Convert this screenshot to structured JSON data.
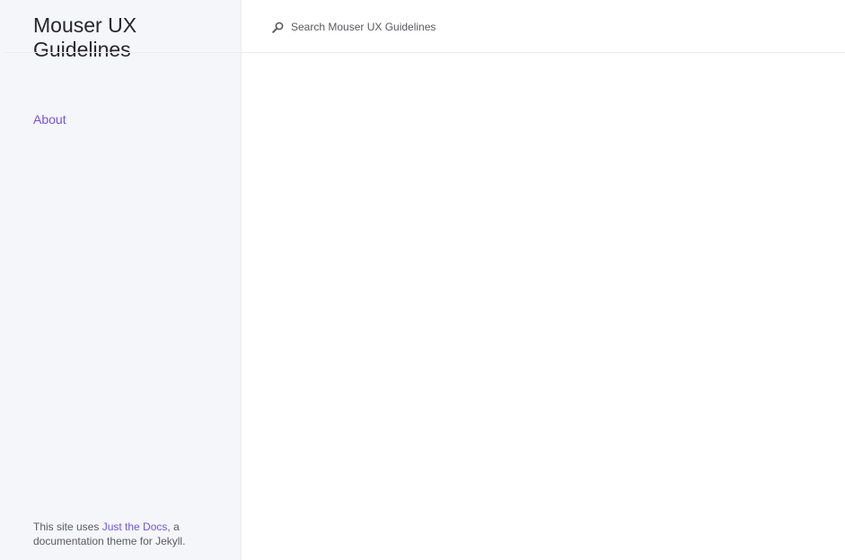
{
  "site": {
    "title": "Mouser UX Guidelines"
  },
  "nav": {
    "items": [
      {
        "label": "About"
      }
    ]
  },
  "search": {
    "placeholder": "Search Mouser UX Guidelines",
    "icon": "search-icon"
  },
  "footer": {
    "prefix": "This site uses ",
    "link_label": "Just the Docs",
    "suffix": ", a documentation theme for Jekyll."
  },
  "colors": {
    "sidebar_bg": "#f5f6fa",
    "link": "#7253ed",
    "text": "#27262b",
    "muted": "#5c5962",
    "border": "#eeebee"
  }
}
